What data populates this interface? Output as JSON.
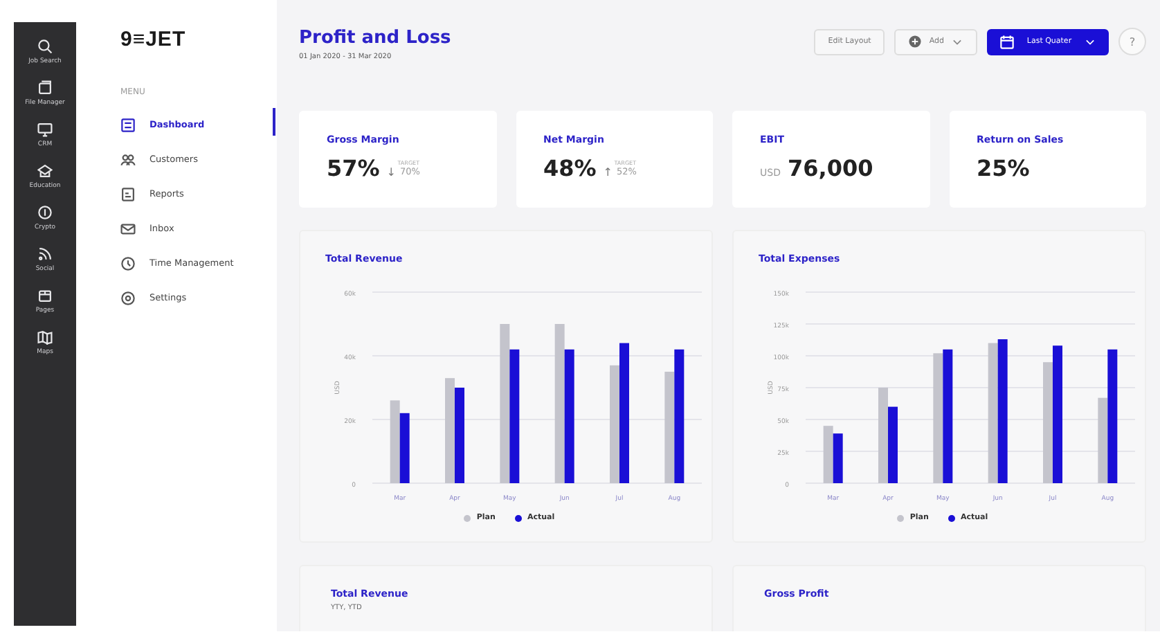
{
  "app_rail": {
    "items": [
      {
        "label": "Job Search",
        "kind": "search"
      },
      {
        "label": "File Manager",
        "kind": "files"
      },
      {
        "label": "CRM",
        "kind": "monitor"
      },
      {
        "label": "Education",
        "kind": "school"
      },
      {
        "label": "Crypto",
        "kind": "coin"
      },
      {
        "label": "Social",
        "kind": "rss"
      },
      {
        "label": "Pages",
        "kind": "box"
      },
      {
        "label": "Maps",
        "kind": "map"
      }
    ]
  },
  "logo": "9≡JET",
  "menu": {
    "heading": "MENU",
    "items": [
      {
        "label": "Dashboard",
        "kind": "grid",
        "selected": true
      },
      {
        "label": "Customers",
        "kind": "people",
        "selected": false
      },
      {
        "label": "Reports",
        "kind": "report",
        "selected": false
      },
      {
        "label": "Inbox",
        "kind": "mail",
        "selected": false
      },
      {
        "label": "Time Management",
        "kind": "clock",
        "selected": false
      },
      {
        "label": "Settings",
        "kind": "gear",
        "selected": false
      }
    ]
  },
  "header": {
    "title": "Profit and Loss",
    "date_range": "01 Jan 2020 - 31 Mar 2020",
    "buttons": [
      {
        "label": "Edit Layout",
        "kind": "outline"
      },
      {
        "label": "Add",
        "kind": "add"
      },
      {
        "label": "Last Quater",
        "kind": "primary"
      },
      {
        "label": "?",
        "kind": "help"
      }
    ]
  },
  "kpis": [
    {
      "title": "Gross Margin",
      "value": "57%",
      "target_label": "TARGET",
      "arrow": "↓",
      "target": "70%"
    },
    {
      "title": "Net Margin",
      "value": "48%",
      "target_label": "TARGET",
      "arrow": "↑",
      "target": "52%"
    },
    {
      "title": "EBIT",
      "prefix": "USD",
      "value": "76,000"
    },
    {
      "title": "Return on Sales",
      "value": "25%"
    }
  ],
  "charts": [
    {
      "title": "Total Revenue",
      "chart_data": {
        "type": "bar",
        "ylabel": "USD",
        "categories": [
          "Mar",
          "Apr",
          "May",
          "Jun",
          "Jul",
          "Aug"
        ],
        "series": [
          {
            "name": "Plan",
            "color": "#c4c4cc",
            "values": [
              26000,
              33000,
              50000,
              50000,
              37000,
              35000
            ]
          },
          {
            "name": "Actual",
            "color": "#1a0fd6",
            "values": [
              22000,
              30000,
              42000,
              42000,
              44000,
              42000
            ]
          }
        ],
        "grid": true,
        "ylim": [
          0,
          60000
        ],
        "yticks": [
          {
            "value": 0,
            "label": "0"
          },
          {
            "value": 20000,
            "label": "20k"
          },
          {
            "value": 40000,
            "label": "40k"
          },
          {
            "value": 60000,
            "label": "60k"
          }
        ]
      }
    },
    {
      "title": "Total Expenses",
      "chart_data": {
        "type": "bar",
        "ylabel": "USD",
        "categories": [
          "Mar",
          "Apr",
          "May",
          "Jun",
          "Jul",
          "Aug"
        ],
        "series": [
          {
            "name": "Plan",
            "color": "#c4c4cc",
            "values": [
              45000,
              75000,
              102000,
              110000,
              95000,
              67000
            ]
          },
          {
            "name": "Actual",
            "color": "#1a0fd6",
            "values": [
              39000,
              60000,
              105000,
              113000,
              108000,
              105000
            ]
          }
        ],
        "grid": true,
        "ylim": [
          0,
          150000
        ],
        "yticks": [
          {
            "value": 0,
            "label": "0"
          },
          {
            "value": 25000,
            "label": "25k"
          },
          {
            "value": 50000,
            "label": "50k"
          },
          {
            "value": 75000,
            "label": "75k"
          },
          {
            "value": 100000,
            "label": "100k"
          },
          {
            "value": 125000,
            "label": "125k"
          },
          {
            "value": 150000,
            "label": "150k"
          }
        ]
      }
    }
  ],
  "bottom_cards": [
    {
      "title": "Total Revenue",
      "subtitle": "YTY, YTD"
    },
    {
      "title": "Gross Profit"
    }
  ]
}
